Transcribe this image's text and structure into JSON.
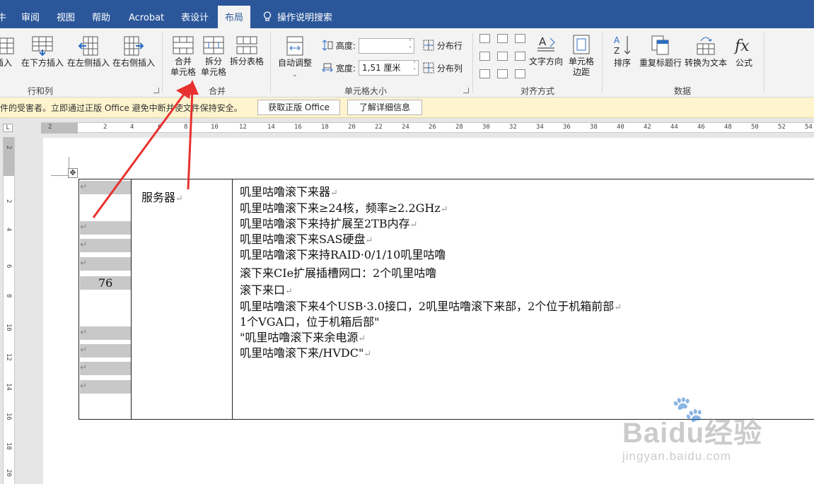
{
  "tabs": {
    "file_fragment": "牛",
    "review": "审阅",
    "view": "视图",
    "help": "帮助",
    "acrobat": "Acrobat",
    "table_design": "表设计",
    "layout": "布局",
    "search": "操作说明搜索"
  },
  "ribbon": {
    "rows_cols": {
      "insert_above_fragment": "插入",
      "insert_below": "在下方插入",
      "insert_left": "在左侧插入",
      "insert_right": "在右侧插入",
      "label": "行和列"
    },
    "merge": {
      "merge_cells_line1": "合并",
      "merge_cells_line2": "单元格",
      "split_cells_line1": "拆分",
      "split_cells_line2": "单元格",
      "split_table": "拆分表格",
      "label": "合并"
    },
    "cell_size": {
      "autofit": "自动调整",
      "height_label": "高度:",
      "height_value": "",
      "width_label": "宽度:",
      "width_value": "1,51 厘米",
      "distribute_rows": "分布行",
      "distribute_cols": "分布列",
      "label": "单元格大小"
    },
    "alignment": {
      "text_direction": "文字方向",
      "cell_margins_line1": "单元格",
      "cell_margins_line2": "边距",
      "label": "对齐方式"
    },
    "data": {
      "sort": "排序",
      "repeat_header": "重复标题行",
      "convert_to_text": "转换为文本",
      "formula": "公式",
      "label": "数据"
    }
  },
  "infobar": {
    "message": "件的受害者。立即通过正版 Office 避免中断并使文件保持安全。",
    "get_genuine": "获取正版 Office",
    "learn_more": "了解详细信息"
  },
  "ruler": {
    "h_labels": [
      "2",
      "2",
      "4",
      "6",
      "8",
      "10",
      "12",
      "14",
      "16",
      "18",
      "20",
      "22",
      "24",
      "26",
      "28",
      "30",
      "32",
      "34",
      "36",
      "38",
      "40",
      "42",
      "44",
      "46",
      "48",
      "50",
      "52",
      "54"
    ],
    "v_labels": [
      "2",
      "2",
      "4",
      "6",
      "8",
      "10",
      "12",
      "14",
      "16",
      "18",
      "20"
    ],
    "corner": "L"
  },
  "document": {
    "col1_number": "76",
    "col2_text": "服务器",
    "col3_lines": [
      "叽里咕噜滚下来器",
      "叽里咕噜滚下来≥24核，频率≥2.2GHz",
      "叽里咕噜滚下来持扩展至2TB内存",
      "叽里咕噜滚下来SAS硬盘",
      "叽里咕噜滚下来持RAID·0/1/10叽里咕噜",
      "滚下来CIe扩展插槽网口：2个叽里咕噜",
      "滚下来口",
      "叽里咕噜滚下来4个USB·3.0接口，2叽里咕噜滚下来部，2个位于机箱前部",
      "1个VGA口，位于机箱后部\"",
      "\"叽里咕噜滚下来余电源",
      "叽里咕噜滚下来/HVDC\""
    ],
    "col3_pilcrow": [
      true,
      true,
      true,
      true,
      false,
      false,
      true,
      true,
      false,
      true,
      true
    ]
  },
  "watermark": {
    "brand": "Baidu经验",
    "url": "jingyan.baidu.com"
  },
  "colors": {
    "tab_bar": "#2b579a",
    "ribbon": "#f3f3f3",
    "infobar": "#fff4ce",
    "arrow": "#e8312f",
    "shade": "#c8c8c8"
  }
}
